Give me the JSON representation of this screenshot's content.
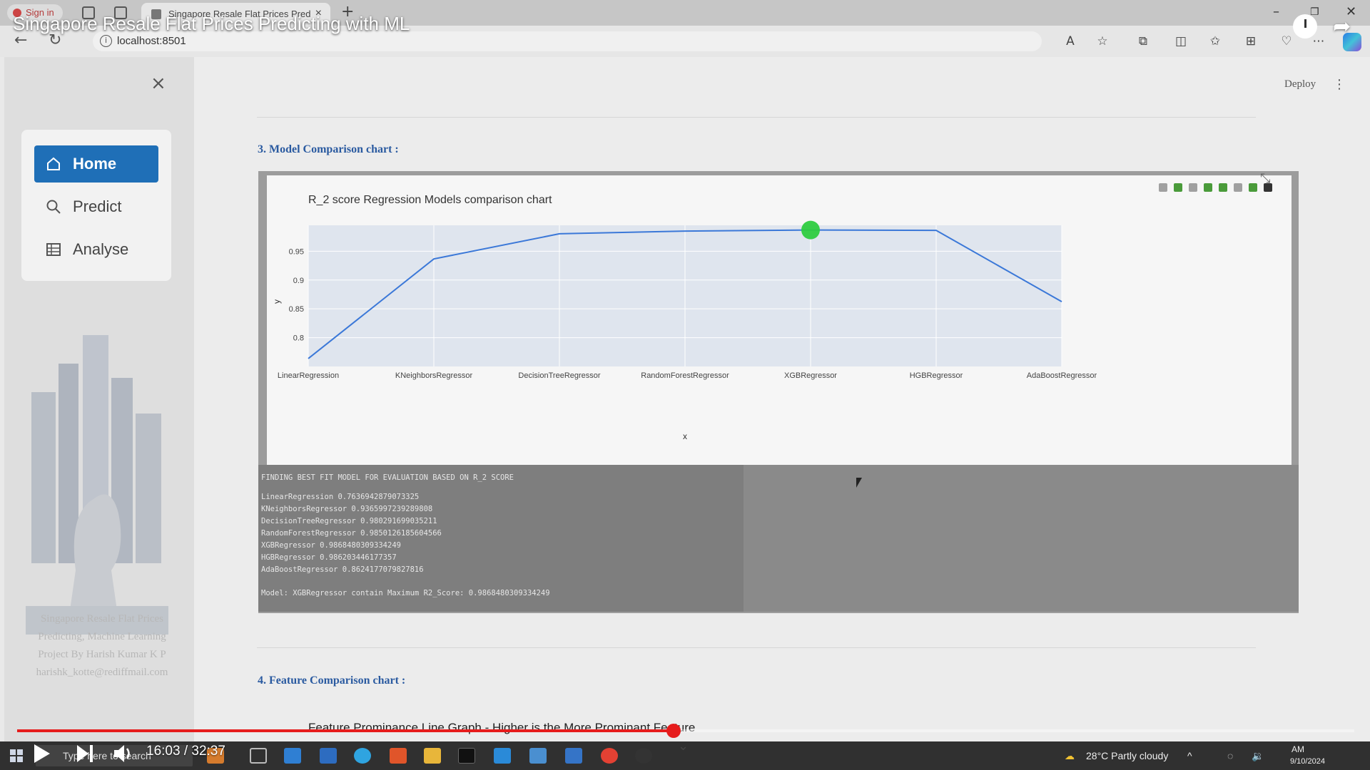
{
  "video": {
    "title": "Singapore Resale Flat Prices Predicting with ML",
    "current_time": "16:03",
    "duration": "32:37",
    "time_separator": "/",
    "progress_fraction": 0.4907,
    "subtitle_text": "Feature Prominance Line Graph - Higher is the More Prominant Feature"
  },
  "browser": {
    "signin_label": "Sign in",
    "tab_title": "Singapore Resale Flat Prices Pred",
    "url": "localhost:8501"
  },
  "app": {
    "deploy_label": "Deploy",
    "nav": [
      {
        "label": "Home",
        "icon": "home-icon",
        "active": true
      },
      {
        "label": "Predict",
        "icon": "search-icon",
        "active": false
      },
      {
        "label": "Analyse",
        "icon": "table-icon",
        "active": false
      }
    ],
    "footer_lines": [
      "Singapore Resale Flat Prices",
      "Predicting, Machine Learning",
      "Project By Harish Kumar K P",
      "harishk_kotte@rediffmail.com"
    ],
    "section3_title": "3. Model Comparison chart :",
    "section4_title": "4. Feature Comparison chart :",
    "console_header": "FINDING BEST FIT MODEL FOR EVALUATION BASED ON R_2 SCORE",
    "console_lines": [
      "LinearRegression 0.7636942879073325",
      "KNeighborsRegressor 0.9365997239289808",
      "DecisionTreeRegressor 0.980291699035211",
      "RandomForestRegressor 0.9850126185604566",
      "XGBRegressor 0.9868480309334249",
      "HGBRegressor 0.986203446177357",
      "AdaBoostRegressor 0.8624177079827816"
    ],
    "console_footer": "Model: XGBRegressor contain Maximum R2_Score: 0.9868480309334249"
  },
  "chart_data": {
    "type": "line",
    "title": "R_2 score Regression Models comparison chart",
    "xlabel": "x",
    "ylabel": "y",
    "categories": [
      "LinearRegression",
      "KNeighborsRegressor",
      "DecisionTreeRegressor",
      "RandomForestRegressor",
      "XGBRegressor",
      "HGBRegressor",
      "AdaBoostRegressor"
    ],
    "values": [
      0.7637,
      0.9366,
      0.9803,
      0.985,
      0.9868,
      0.9862,
      0.8624
    ],
    "y_ticks": [
      0.8,
      0.85,
      0.9,
      0.95
    ],
    "ylim": [
      0.75,
      0.995
    ],
    "highlight_index": 4,
    "line_color": "#3b78d8",
    "plot_bg": "#dfe5ee",
    "marker_color": "#2ecc40",
    "grid": true
  },
  "taskbar": {
    "search_placeholder": "Type here to search",
    "weather": "28°C  Partly cloudy",
    "date": "9/10/2024",
    "time_suffix": "AM"
  }
}
